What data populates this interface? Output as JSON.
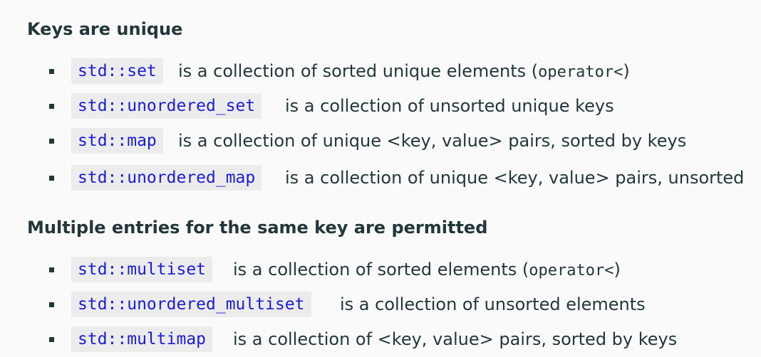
{
  "sections": [
    {
      "title": "Keys are unique",
      "items": [
        {
          "code": "std::set",
          "desc": "is a collection of sorted unique elements (",
          "op": "operator<",
          "close": ")"
        },
        {
          "code": "std::unordered_set",
          "desc": "is a collection of unsorted unique keys"
        },
        {
          "code": "std::map",
          "desc": "is a collection of unique <key, value> pairs, sorted by keys"
        },
        {
          "code": "std::unordered_map",
          "desc": "is a collection of unique <key, value> pairs, unsorted"
        }
      ]
    },
    {
      "title": "Multiple entries for the same key are permitted",
      "items": [
        {
          "code": "std::multiset",
          "desc": "is a collection of sorted elements (",
          "op": "operator<",
          "close": ")"
        },
        {
          "code": "std::unordered_multiset",
          "desc": "is a collection of unsorted elements"
        },
        {
          "code": "std::multimap",
          "desc": "is a collection of <key, value> pairs, sorted by keys"
        }
      ]
    }
  ]
}
